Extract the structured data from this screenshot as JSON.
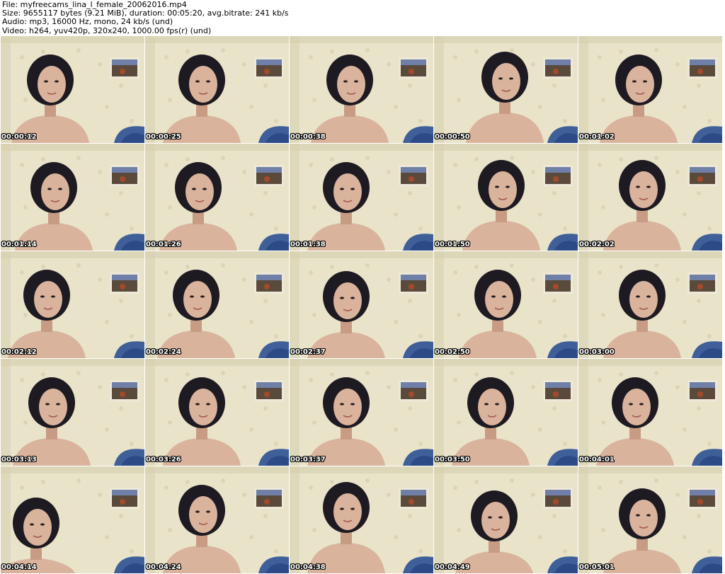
{
  "header": {
    "file_line": "File: myfreecams_lina_l_female_20062016.mp4",
    "size_line": "Size: 9655117 bytes (9.21 MiB), duration: 00:05:20, avg.bitrate: 241 kb/s",
    "audio_line": "Audio: mp3, 16000 Hz, mono, 24 kb/s (und)",
    "video_line": "Video: h264, yuv420p, 320x240, 1000.00 fps(r) (und)"
  },
  "thumbnails": [
    {
      "timestamp": "00:00:12"
    },
    {
      "timestamp": "00:00:25"
    },
    {
      "timestamp": "00:00:38"
    },
    {
      "timestamp": "00:00:50"
    },
    {
      "timestamp": "00:01:02"
    },
    {
      "timestamp": "00:01:14"
    },
    {
      "timestamp": "00:01:26"
    },
    {
      "timestamp": "00:01:38"
    },
    {
      "timestamp": "00:01:50"
    },
    {
      "timestamp": "00:02:02"
    },
    {
      "timestamp": "00:02:12"
    },
    {
      "timestamp": "00:02:24"
    },
    {
      "timestamp": "00:02:37"
    },
    {
      "timestamp": "00:02:50"
    },
    {
      "timestamp": "00:03:00"
    },
    {
      "timestamp": "00:03:13"
    },
    {
      "timestamp": "00:03:26"
    },
    {
      "timestamp": "00:03:37"
    },
    {
      "timestamp": "00:03:50"
    },
    {
      "timestamp": "00:04:01"
    },
    {
      "timestamp": "00:04:14"
    },
    {
      "timestamp": "00:04:24"
    },
    {
      "timestamp": "00:04:38"
    },
    {
      "timestamp": "00:04:49"
    },
    {
      "timestamp": "00:05:01"
    }
  ],
  "colors": {
    "wall": "#e9e3ca",
    "wall_shadow": "#d6cfae",
    "hair": "#1d1a22",
    "skin": "#d9b39c",
    "skin_shade": "#c89c84",
    "blanket": "#3f5f99",
    "poster": "#5a4a3c",
    "poster_frame": "#eee8d8",
    "timestamp_text": "#ffffff"
  }
}
